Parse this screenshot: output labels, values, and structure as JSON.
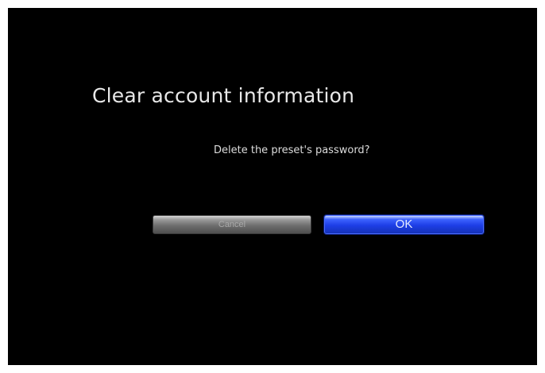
{
  "dialog": {
    "title": "Clear account information",
    "message": "Delete the preset's password?"
  },
  "buttons": {
    "cancel_label": "Cancel",
    "ok_label": "OK"
  },
  "colors": {
    "background": "#000000",
    "ok_button": "#1d3ee6",
    "cancel_button": "#6e6e6e"
  }
}
